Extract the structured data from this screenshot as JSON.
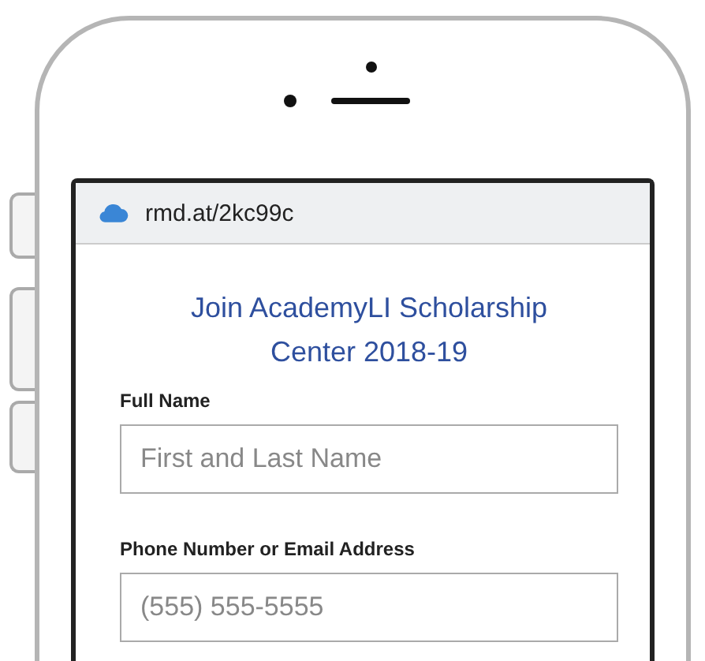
{
  "browser": {
    "url": "rmd.at/2kc99c"
  },
  "form": {
    "title": "Join AcademyLI Scholarship Center 2018-19",
    "fields": [
      {
        "label": "Full Name",
        "placeholder": "First and Last Name"
      },
      {
        "label": "Phone Number or Email Address",
        "placeholder": "(555) 555-5555"
      }
    ]
  }
}
